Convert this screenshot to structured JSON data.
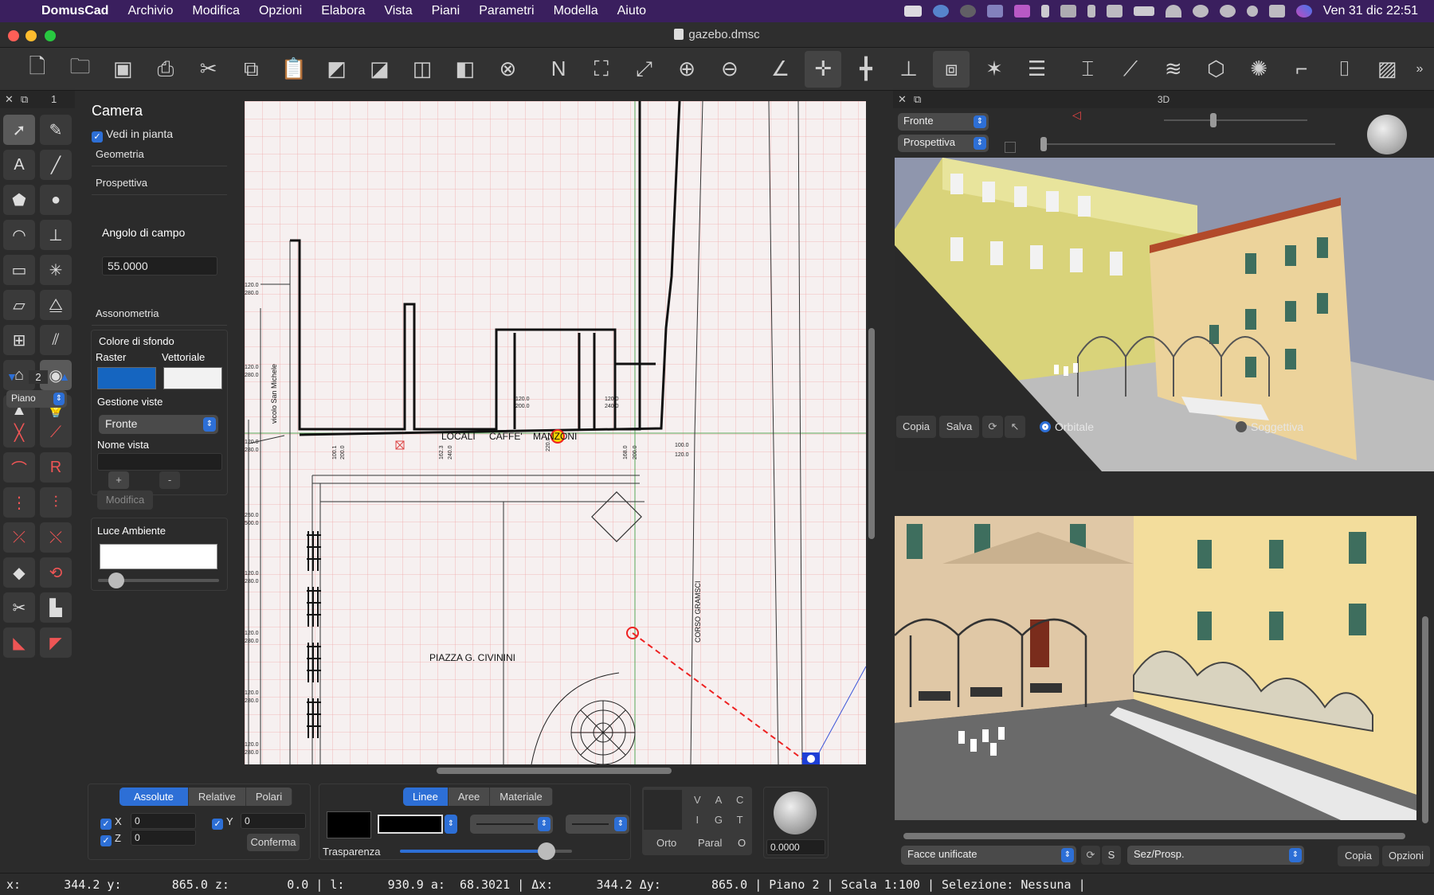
{
  "menubar": {
    "app_name": "DomusCad",
    "items": [
      "Archivio",
      "Modifica",
      "Opzioni",
      "Elabora",
      "Vista",
      "Piani",
      "Parametri",
      "Modella",
      "Aiuto"
    ],
    "clock": "Ven 31 dic  22:51"
  },
  "window": {
    "title": "gazebo.dmsc"
  },
  "left_panel": {
    "number": "1",
    "level": "2",
    "floor_select": "Piano"
  },
  "camera": {
    "title": "Camera",
    "show_in_plan": "Vedi in pianta",
    "geometry": "Geometria",
    "perspective": "Prospettiva",
    "fov_label": "Angolo di campo",
    "fov_value": "55.0000",
    "axonometry": "Assonometria",
    "bg_color_label": "Colore di sfondo",
    "raster_label": "Raster",
    "vector_label": "Vettoriale",
    "raster_color": "#1565c0",
    "vector_color": "#f2f2f2",
    "views_label": "Gestione viste",
    "views_select": "Fronte",
    "view_name_label": "Nome vista",
    "view_name_value": "",
    "add": "+",
    "remove": "-",
    "modify": "Modifica",
    "ambient_label": "Luce Ambiente",
    "ambient_slider": 0.15
  },
  "plan": {
    "labels": {
      "locali": "LOCALI",
      "caffe": "CAFFE'",
      "manzoni": "MANZONI",
      "piazza": "PIAZZA G. CIVININI",
      "vicolo": "vicolo San Michele",
      "corso": "CORSO GRAMSCI"
    },
    "dims": {
      "d1200": "120.0",
      "d2800": "280.0",
      "d2500": "250.0",
      "d5000": "500.0",
      "d1000": "100.0",
      "d1001": "100.1",
      "d2000": "200.0",
      "d1623": "162.3",
      "d2400": "240.0",
      "d1680": "168.0",
      "d2200": "220.0"
    }
  },
  "view3d": {
    "title": "3D",
    "select_view": "Fronte",
    "select_mode": "Prospettiva",
    "btn_copy": "Copia",
    "btn_save": "Salva",
    "radio_orbital": "Orbitale",
    "radio_subjective": "Soggettiva",
    "faces_select": "Facce unificate",
    "btn_s": "S",
    "section_select": "Sez/Prosp.",
    "btn_copy2": "Copia",
    "btn_options": "Opzioni"
  },
  "coords": {
    "tabs": [
      "Assolute",
      "Relative",
      "Polari"
    ],
    "active_tab": "Assolute",
    "x_label": "X",
    "x_value": "0",
    "y_label": "Y",
    "y_value": "0",
    "z_label": "Z",
    "z_value": "0",
    "confirm": "Conferma"
  },
  "style": {
    "tabs": [
      "Linee",
      "Aree",
      "Materiale"
    ],
    "active_tab": "Linee",
    "transparency_label": "Trasparenza",
    "transparency_value": 0.85,
    "fill_color": "#000000",
    "line_color": "#000000"
  },
  "snap": {
    "grid": [
      [
        "V",
        "A",
        "C"
      ],
      [
        "I",
        "G",
        "T"
      ]
    ],
    "ortho": "Orto",
    "parallel": "Paral",
    "zero": "O",
    "angle_value": "0.0000"
  },
  "statusbar": {
    "text": "x:      344.2 y:       865.0 z:        0.0 | l:      930.9 a:  68.3021 | Δx:      344.2 Δy:       865.0 | Piano 2 | Scala 1:100 | Selezione: Nessuna |"
  }
}
